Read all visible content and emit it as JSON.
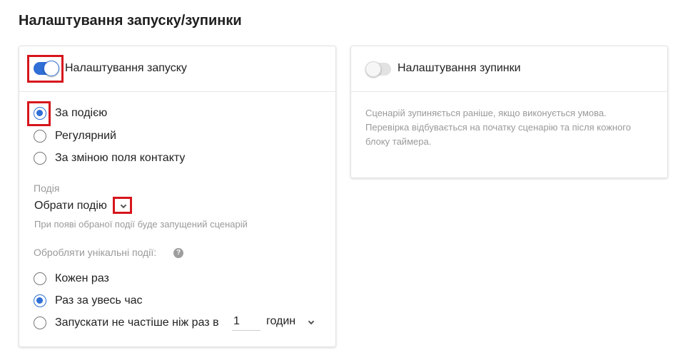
{
  "page": {
    "title": "Налаштування запуску/зупинки"
  },
  "launch": {
    "header_label": "Налаштування запуску",
    "toggle_on": true,
    "trigger_options": [
      "За подією",
      "Регулярний",
      "За зміною поля контакту"
    ],
    "trigger_selected": 0,
    "event_caption": "Подія",
    "event_value": "Обрати подію",
    "event_hint": "При появі обраної події буде запущений сценарій",
    "unique_caption": "Обробляти унікальні події:",
    "help_symbol": "?",
    "unique_options": [
      "Кожен раз",
      "Раз за увесь час",
      "Запускати не частіше ніж раз в"
    ],
    "unique_selected": 1,
    "interval_value": "1",
    "interval_unit": "годин"
  },
  "stop": {
    "header_label": "Налаштування зупинки",
    "toggle_on": false,
    "description": "Сценарій зупиняється раніше, якщо виконується умова. Перевірка відбувається на початку сценарію та після кожного блоку таймера."
  },
  "colors": {
    "accent": "#2f6fd6",
    "highlight": "#d6161c",
    "muted_text": "#9a9a9a"
  }
}
